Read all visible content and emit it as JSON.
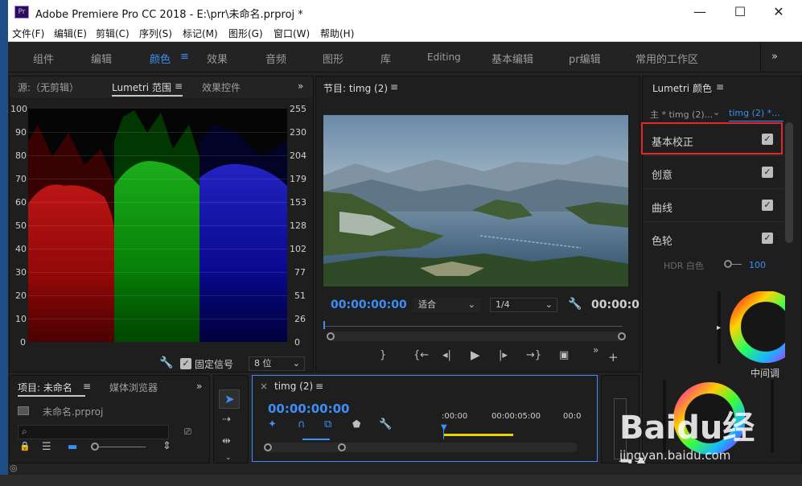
{
  "window": {
    "app_logo": "Pr",
    "title": "Adobe Premiere Pro CC 2018 - E:\\prr\\未命名.prproj *",
    "minimize": "—",
    "maximize": "☐",
    "close": "✕"
  },
  "menu": [
    "文件(F)",
    "编辑(E)",
    "剪辑(C)",
    "序列(S)",
    "标记(M)",
    "图形(G)",
    "窗口(W)",
    "帮助(H)"
  ],
  "workspaces": [
    "组件",
    "编辑",
    "颜色",
    "效果",
    "音频",
    "图形",
    "库",
    "Editing",
    "基本编辑",
    "pr编辑",
    "常用的工作区"
  ],
  "workspace_active": "颜色",
  "workspace_more": "»",
  "source_panel": {
    "tabs": [
      "源:（无剪辑）",
      "Lumetri 范围",
      "效果控件"
    ],
    "menu_icon": "≡",
    "more": "»",
    "scope_left_ticks": [
      "100",
      "90",
      "80",
      "70",
      "60",
      "50",
      "40",
      "30",
      "20",
      "10",
      "0"
    ],
    "scope_right_ticks": [
      "255",
      "230",
      "204",
      "179",
      "153",
      "128",
      "102",
      "77",
      "51",
      "26",
      "0"
    ],
    "clamp_label": "固定信号",
    "bit_depth": "8 位"
  },
  "program_panel": {
    "title": "节目: timg (2)",
    "menu_icon": "≡",
    "timecode_in": "00:00:00:00",
    "fit": "适合",
    "resolution": "1/4",
    "timecode_out": "00:00:0"
  },
  "lumetri_panel": {
    "title": "Lumetri 颜色",
    "menu_icon": "≡",
    "master_clip": "主 * timg (2)...",
    "sequence_clip": "timg (2) *...",
    "sections": [
      {
        "label": "基本校正",
        "checked": true
      },
      {
        "label": "创意",
        "checked": true
      },
      {
        "label": "曲线",
        "checked": true
      },
      {
        "label": "色轮",
        "checked": true
      }
    ],
    "hdr_label": "HDR 白色",
    "hdr_value": "100",
    "midtones_label": "中间调"
  },
  "project_panel": {
    "tabs": [
      "项目: 未命名",
      "媒体浏览器"
    ],
    "menu_icon": "≡",
    "more": "»",
    "file": "未命名.prproj"
  },
  "timeline_panel": {
    "title": "timg (2)",
    "menu_icon": "≡",
    "close": "×",
    "timecode": "00:00:00:00",
    "ruler": [
      ":00:00",
      "00:00:05:00",
      "00:0"
    ]
  },
  "watermark": {
    "brand": "Baidu经验",
    "url": "jingyan.baidu.com"
  },
  "colors": {
    "accent_blue": "#3b8ff6",
    "highlight_red": "#e3262a",
    "panel_bg": "#1e1e1e"
  }
}
